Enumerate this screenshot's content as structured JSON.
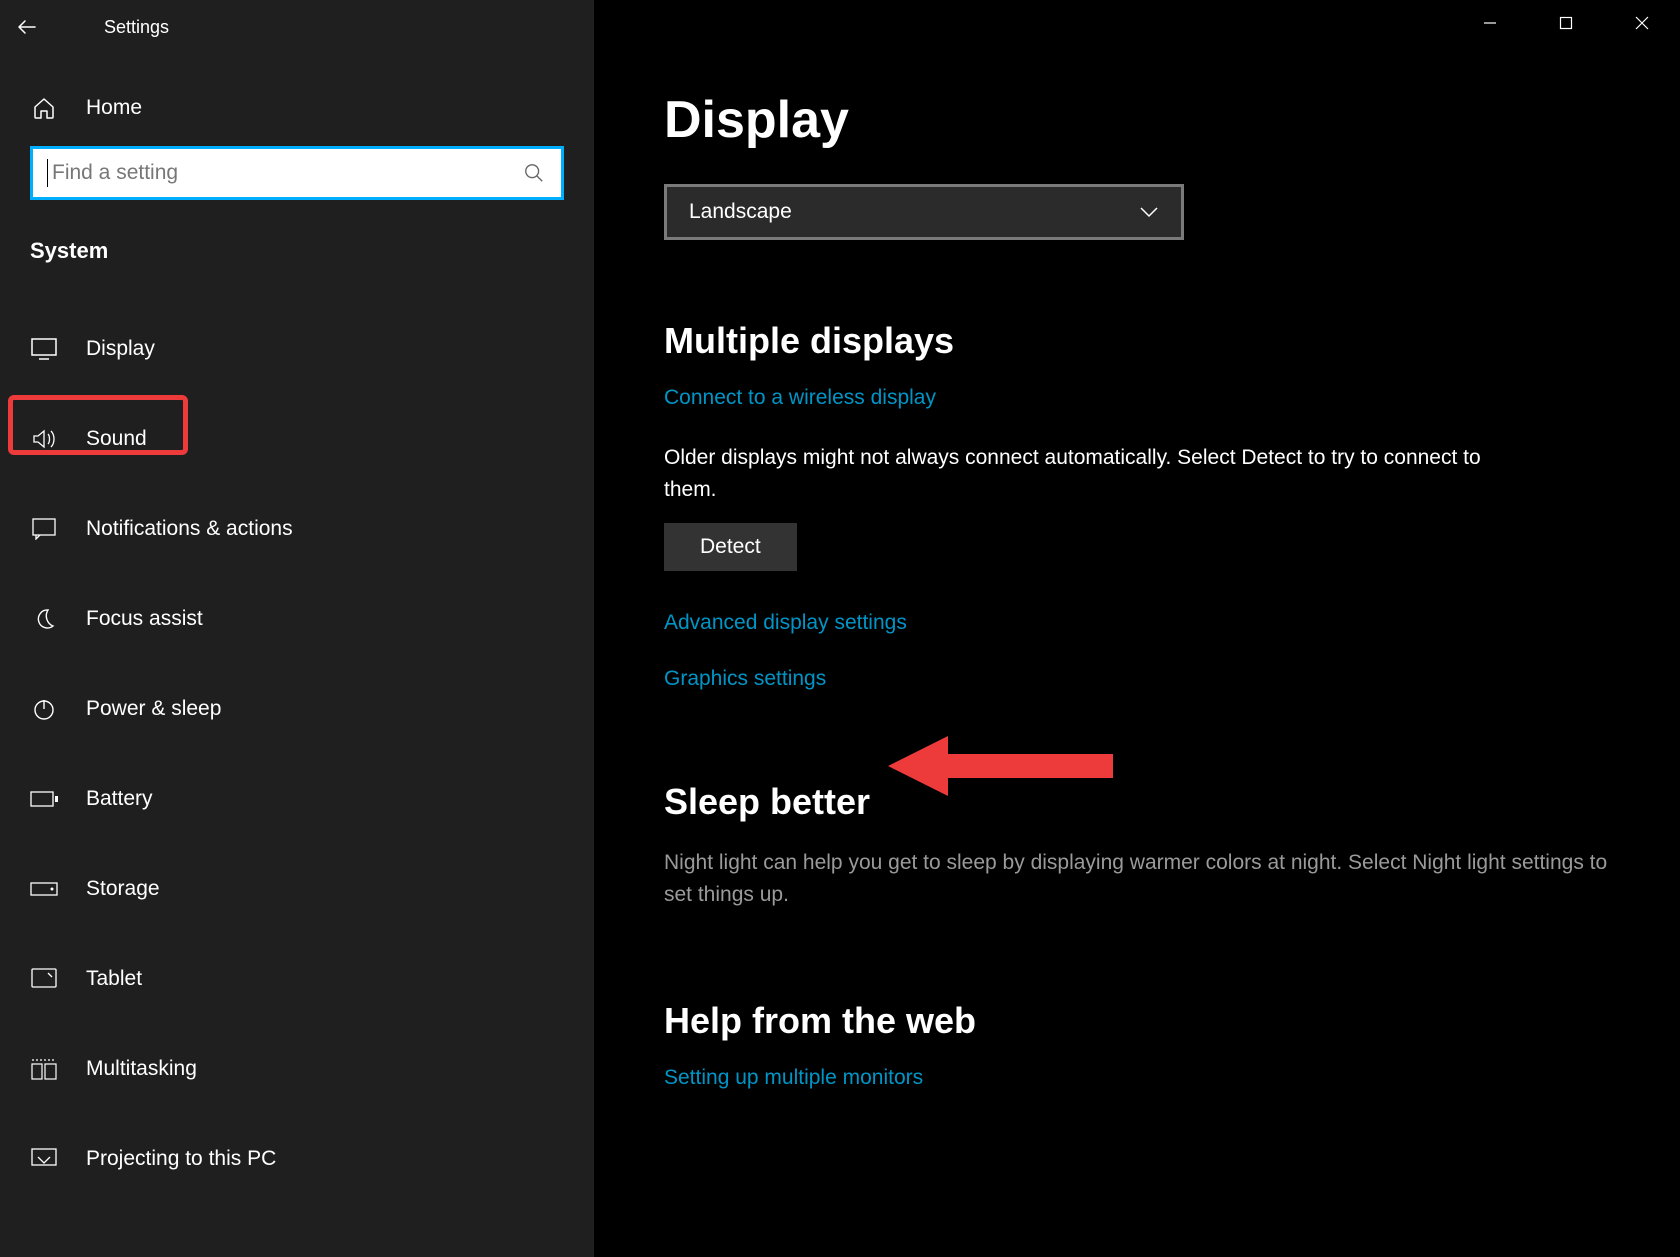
{
  "app_title": "Settings",
  "home_label": "Home",
  "search_placeholder": "Find a setting",
  "section_label": "System",
  "sidebar": {
    "items": [
      {
        "label": "Display"
      },
      {
        "label": "Sound"
      },
      {
        "label": "Notifications & actions"
      },
      {
        "label": "Focus assist"
      },
      {
        "label": "Power & sleep"
      },
      {
        "label": "Battery"
      },
      {
        "label": "Storage"
      },
      {
        "label": "Tablet"
      },
      {
        "label": "Multitasking"
      },
      {
        "label": "Projecting to this PC"
      }
    ]
  },
  "main": {
    "title": "Display",
    "orientation_value": "Landscape",
    "multi_heading": "Multiple displays",
    "wireless_link": "Connect to a wireless display",
    "detect_help": "Older displays might not always connect automatically. Select Detect to try to connect to them.",
    "detect_label": "Detect",
    "adv_link": "Advanced display settings",
    "gfx_link": "Graphics settings",
    "sleep_heading": "Sleep better",
    "sleep_text": "Night light can help you get to sleep by displaying warmer colors at night. Select Night light settings to set things up.",
    "help_heading": "Help from the web",
    "help_link": "Setting up multiple monitors"
  }
}
